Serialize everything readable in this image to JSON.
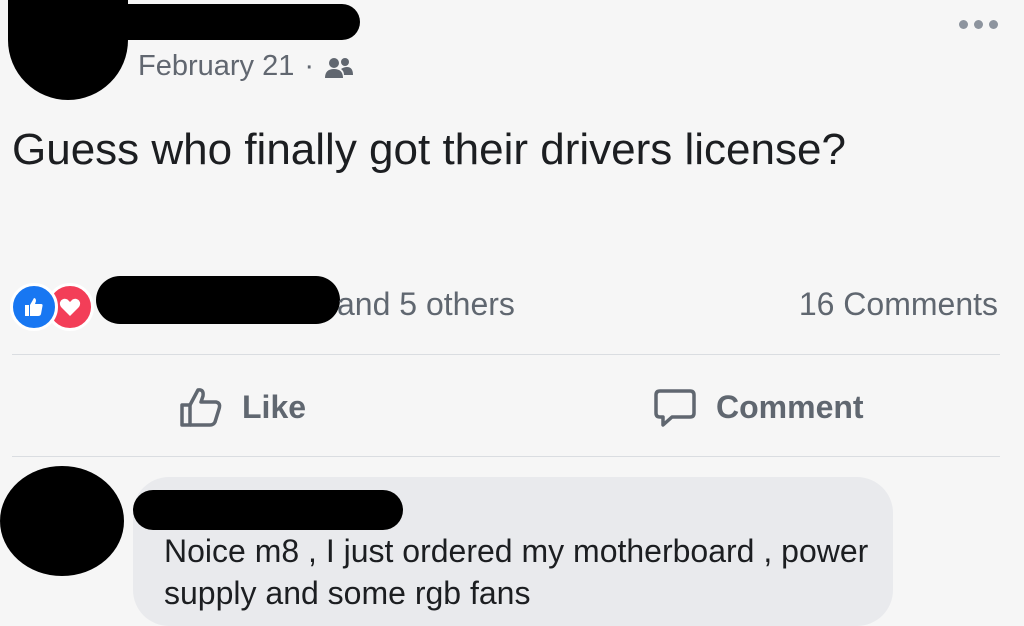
{
  "post": {
    "date": "February 21",
    "separator": "·",
    "audience_icon": "friends-icon",
    "text": "Guess who finally got their drivers license?",
    "reactions": {
      "icons": [
        "like-reaction-icon",
        "love-reaction-icon"
      ],
      "names_suffix": "and 5 others",
      "comments_count": "16 Comments"
    },
    "actions": {
      "like_label": "Like",
      "comment_label": "Comment"
    }
  },
  "comment": {
    "text": "Noice m8 , I just ordered my motherboard , power supply and some rgb fans"
  },
  "colors": {
    "like_blue": "#1877f2",
    "love_red": "#f33e58",
    "secondary_text": "#606770",
    "bubble_bg": "#e9eaed"
  }
}
